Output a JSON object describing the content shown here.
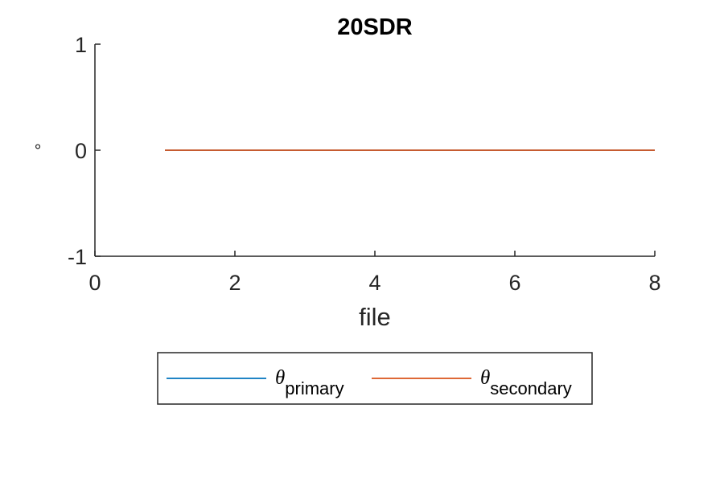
{
  "chart_data": {
    "type": "line",
    "title": "20SDR",
    "xlabel": "file",
    "ylabel": "°",
    "xlim": [
      0,
      8
    ],
    "ylim": [
      -1,
      1
    ],
    "x_ticks": [
      0,
      2,
      4,
      6,
      8
    ],
    "y_ticks": [
      -1,
      0,
      1
    ],
    "x_tick_labels": [
      "0",
      "2",
      "4",
      "6",
      "8"
    ],
    "y_tick_labels": [
      "-1",
      "0",
      "1"
    ],
    "grid": false,
    "legend_placement": "bottom-outside",
    "series": [
      {
        "name_symbol": "θ",
        "name_subscript": "primary",
        "color": "#0072BD",
        "x": [
          1,
          2,
          3,
          4,
          5,
          6,
          7,
          8
        ],
        "values": [
          0,
          0,
          0,
          0,
          0,
          0,
          0,
          0
        ]
      },
      {
        "name_symbol": "θ",
        "name_subscript": "secondary",
        "color": "#D95319",
        "x": [
          1,
          2,
          3,
          4,
          5,
          6,
          7,
          8
        ],
        "values": [
          0,
          0,
          0,
          0,
          0,
          0,
          0,
          0
        ]
      }
    ]
  }
}
